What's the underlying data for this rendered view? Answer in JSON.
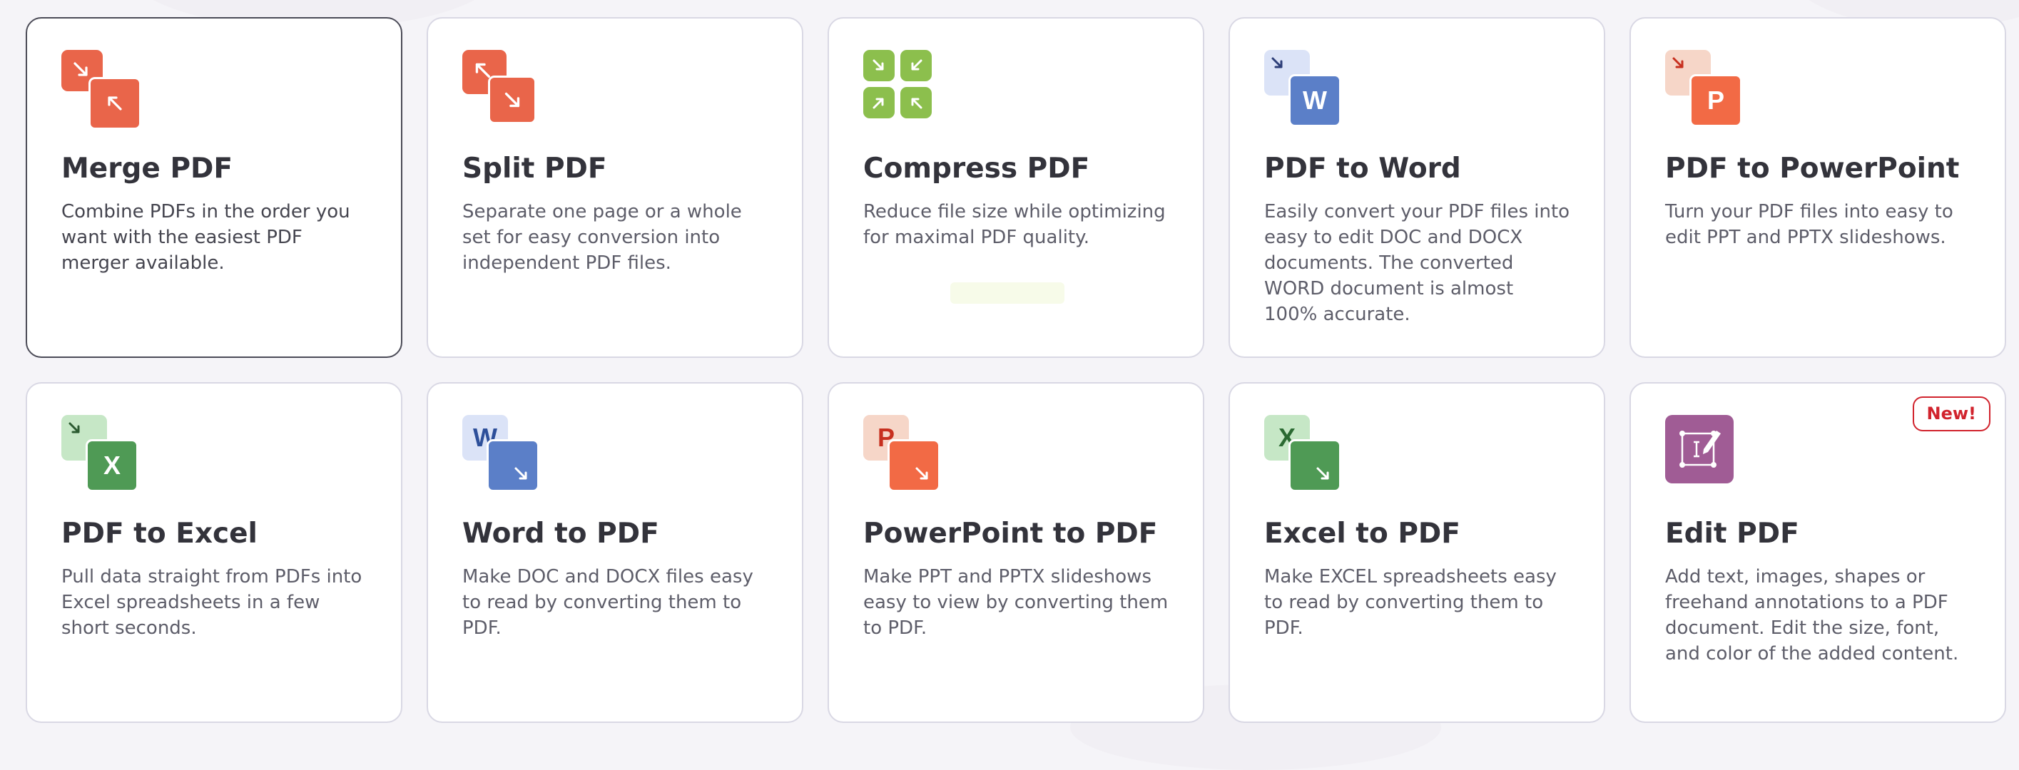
{
  "colors": {
    "pdf_red": "#e9654a",
    "pdf_red_light": "#f5d3c5",
    "compress_green": "#8cbf4d",
    "word_blue": "#5b7fc8",
    "word_blue_light": "#dbe3f7",
    "ppt_orange": "#f26a45",
    "ppt_light": "#f6d6c8",
    "excel_green": "#4f9a55",
    "excel_light": "#c6e7c6",
    "edit_purple": "#a05c95",
    "badge_red": "#d1232d"
  },
  "tools": [
    {
      "name": "Merge PDF",
      "description": "Combine PDFs in the order you want with the easiest PDF merger available.",
      "icon": "merge-icon",
      "selected": true
    },
    {
      "name": "Split PDF",
      "description": "Separate one page or a whole set for easy conversion into independent PDF files.",
      "icon": "split-icon"
    },
    {
      "name": "Compress PDF",
      "description": "Reduce file size while optimizing for maximal PDF quality.",
      "icon": "compress-icon"
    },
    {
      "name": "PDF to Word",
      "description": "Easily convert your PDF files into easy to edit DOC and DOCX documents. The converted WORD document is almost 100% accurate.",
      "icon": "pdf-to-word-icon",
      "icon_letter": "W"
    },
    {
      "name": "PDF to PowerPoint",
      "description": "Turn your PDF files into easy to edit PPT and PPTX slideshows.",
      "icon": "pdf-to-powerpoint-icon",
      "icon_letter": "P"
    },
    {
      "name": "PDF to Excel",
      "description": "Pull data straight from PDFs into Excel spreadsheets in a few short seconds.",
      "icon": "pdf-to-excel-icon",
      "icon_letter": "X"
    },
    {
      "name": "Word to PDF",
      "description": "Make DOC and DOCX files easy to read by converting them to PDF.",
      "icon": "word-to-pdf-icon",
      "icon_letter": "W"
    },
    {
      "name": "PowerPoint to PDF",
      "description": "Make PPT and PPTX slideshows easy to view by converting them to PDF.",
      "icon": "powerpoint-to-pdf-icon",
      "icon_letter": "P"
    },
    {
      "name": "Excel to PDF",
      "description": "Make EXCEL spreadsheets easy to read by converting them to PDF.",
      "icon": "excel-to-pdf-icon",
      "icon_letter": "X"
    },
    {
      "name": "Edit PDF",
      "description": "Add text, images, shapes or freehand annotations to a PDF document. Edit the size, font, and color of the added content.",
      "icon": "edit-pdf-icon",
      "badge": "New!"
    }
  ]
}
